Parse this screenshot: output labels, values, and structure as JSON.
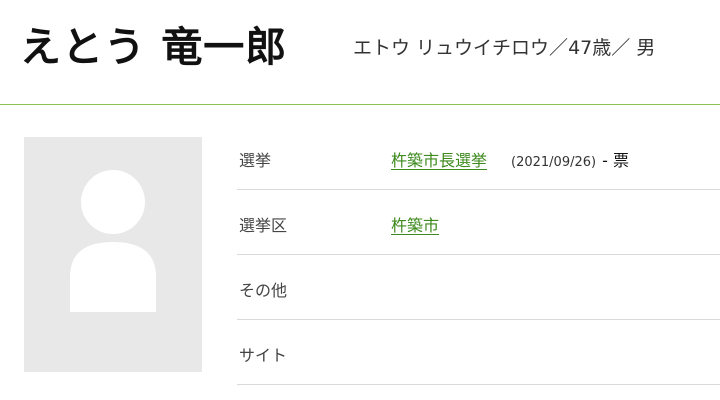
{
  "profile": {
    "name": "えとう 竜一郎",
    "kana": "エトウ リュウイチロウ",
    "sep1": "／",
    "age": "47歳",
    "sep2": "／",
    "gender": "男"
  },
  "photo": {
    "icon": "person-placeholder-icon"
  },
  "info": {
    "election": {
      "label": "選挙",
      "value": "杵築市長選挙",
      "date": "(2021/09/26)",
      "votes": "- 票"
    },
    "district": {
      "label": "選挙区",
      "value": "杵築市"
    },
    "other": {
      "label": "その他",
      "value": ""
    },
    "site": {
      "label": "サイト",
      "value": ""
    }
  },
  "colors": {
    "accent": "#8ac554",
    "link": "#3d8a1d",
    "placeholder_bg": "#e8e8e8"
  }
}
